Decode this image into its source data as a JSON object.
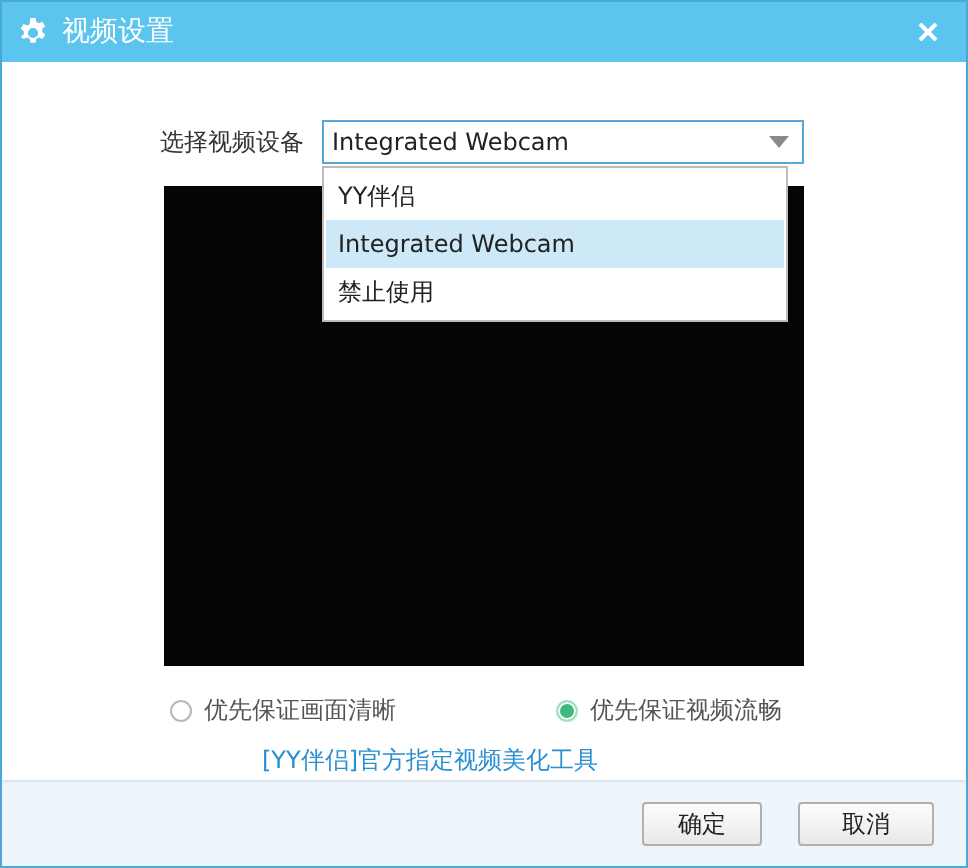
{
  "window": {
    "title": "视频设置"
  },
  "device": {
    "label": "选择视频设备",
    "value": "Integrated Webcam",
    "expanded": true,
    "options": [
      {
        "label": "YY伴侣",
        "selected": false
      },
      {
        "label": "Integrated Webcam",
        "selected": true
      },
      {
        "label": "禁止使用",
        "selected": false
      }
    ]
  },
  "quality": [
    {
      "label": "优先保证画面清晰",
      "selected": false
    },
    {
      "label": "优先保证视频流畅",
      "selected": true
    }
  ],
  "link": "[YY伴侣]官方指定视频美化工具",
  "buttons": [
    "确定",
    "取消"
  ]
}
